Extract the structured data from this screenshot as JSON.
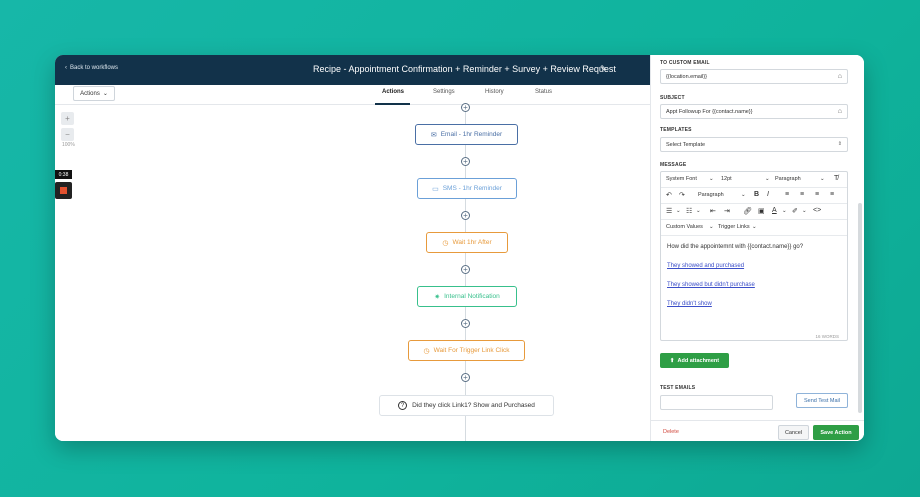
{
  "header": {
    "back_label": "Back to workflows",
    "title": "Recipe - Appointment Confirmation + Reminder + Survey + Review Request"
  },
  "toolbar": {
    "actions_label": "Actions"
  },
  "tabs": [
    {
      "label": "Actions",
      "active": true
    },
    {
      "label": "Settings",
      "active": false
    },
    {
      "label": "History",
      "active": false
    },
    {
      "label": "Status",
      "active": false
    }
  ],
  "canvas": {
    "zoom_in": "+",
    "zoom_out": "−",
    "zoom_level": "100%",
    "timer": "0:38"
  },
  "nodes": [
    {
      "label": "Email - 1hr Reminder",
      "icon": "email-icon",
      "color": "#4a6fa5"
    },
    {
      "label": "SMS - 1hr Reminder",
      "icon": "chat-icon",
      "color": "#6ba0d8"
    },
    {
      "label": "Wait 1hr After",
      "icon": "clock-icon",
      "color": "#e79a3c"
    },
    {
      "label": "Internal Notification",
      "icon": "bell-icon",
      "color": "#38c08c"
    },
    {
      "label": "Wait For Trigger Link Click",
      "icon": "clock-icon",
      "color": "#e79a3c"
    }
  ],
  "condition": {
    "label": "Did they click Link1? Show and Purchased"
  },
  "panel": {
    "to_email_label": "TO CUSTOM EMAIL",
    "to_email_value": "{{location.email}}",
    "subject_label": "SUBJECT",
    "subject_value": "Appt Followup For {{contact.name}}",
    "templates_label": "TEMPLATES",
    "templates_value": "Select Template",
    "message_label": "MESSAGE",
    "editor": {
      "font_family": "System Font",
      "font_size": "12pt",
      "block_format": "Paragraph",
      "block_format_2": "Paragraph",
      "custom_values": "Custom Values",
      "trigger_links": "Trigger Links",
      "body_line": "How did the appointemnt with {{contact.name}} go?",
      "links": [
        "They showed and purchased",
        "They showed but didn't purchase",
        "They didn't show"
      ],
      "word_count": "16 WORDS"
    },
    "add_attachment": "Add attachment",
    "test_emails_label": "TEST EMAILS",
    "send_test_mail": "Send Test Mail",
    "delete": "Delete",
    "cancel": "Cancel",
    "save_action": "Save Action"
  },
  "colors": {
    "header_bg": "#12324a",
    "primary_green": "#2e9e45",
    "link_blue": "#3b4ec8",
    "danger": "#d1493e"
  }
}
